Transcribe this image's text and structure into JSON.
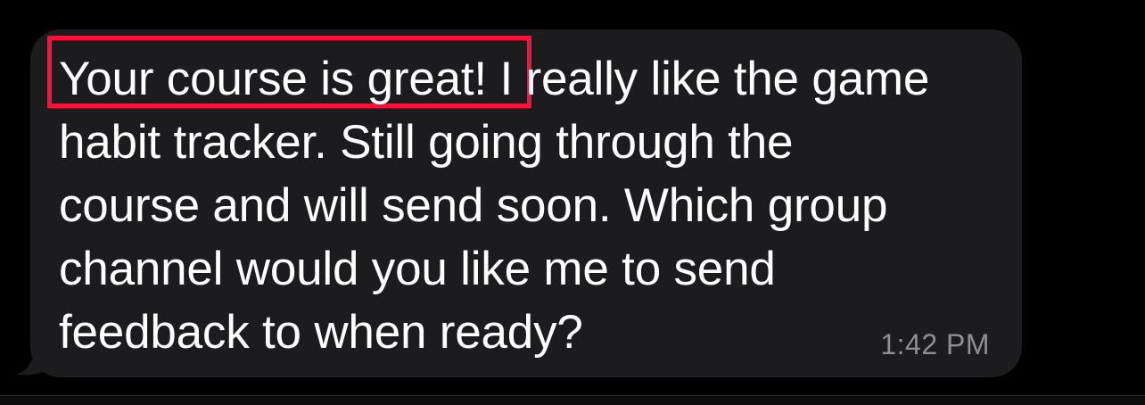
{
  "message": {
    "highlighted_text": "Your course is great!",
    "line1_rest": " I really like the game",
    "line2": "habit tracker. Still going through the",
    "line3": "course and will send soon. Which group",
    "line4": "channel would you like me to send",
    "line5": "feedback to when ready?",
    "timestamp": "1:42 PM"
  },
  "colors": {
    "background": "#000000",
    "bubble": "#1c1c1e",
    "text": "#ffffff",
    "timestamp": "#8e8e93",
    "highlight_border": "#ff0f3c"
  }
}
